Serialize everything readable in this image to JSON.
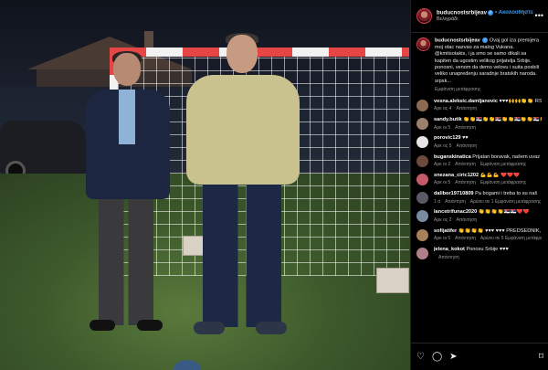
{
  "post": {
    "username": "buducnostsrbijeav",
    "verified_mark": "✓",
    "follow_label": "• Ακολουθήστε",
    "location": "Βελιγράδι",
    "more_icon": "more-horizontal-icon"
  },
  "caption": {
    "username": "buducnostsrbijeav",
    "text": "Ovaj gol iza premijera moj otac nazvao za malog Vukana. @kmitsotakis, i ja smo se samo dikali sa kapiten da ugostim velikog prijatelja Srbije. ponosni, venom da demo velovu i suita posbili veliko unapređenju saradnje bratskih naroda. srpsk...",
    "meta": "Εμφάνιση μετάφρασης"
  },
  "comments": [
    {
      "username": "vesna.aleksic.damljanovic",
      "text": "♥♥♥🙌🙌👏👏 RSCR🙌🙌😊👏 RSCR",
      "time": "Αρκ ος 4",
      "extra": "",
      "color": "#8a6a52"
    },
    {
      "username": "sandy.butik",
      "text": "👏👏🇷🇸👏👏🇷🇸👏👏🇷🇸👏👏🇷🇸👏👏 ❤️❤️💙❤️",
      "time": "Αρκ οι 5",
      "extra": "",
      "color": "#9c7f6c"
    },
    {
      "username": "porovic129",
      "text": "♥♥",
      "time": "Αρκ ος 5",
      "extra": "",
      "color": "#e6e6e6"
    },
    {
      "username": "buganskinatica",
      "text": "Prijatan boravak, našem uvaz",
      "time": "Αρκ οι 2",
      "extra": "Εμφάνιση μετάφρασης",
      "color": "#6a4a3a"
    },
    {
      "username": "snezana_ciric1202",
      "text": "💪💪💪 ❤️❤️❤️",
      "time": "Αρκ οι 5",
      "extra": "Εμφάνιση μετάφρασης",
      "color": "#c45a6a"
    },
    {
      "username": "dalibor19710809",
      "text": "Pa bogami i treba to su naš",
      "time": "1 α",
      "extra": "Αρέσει σε 1   Εμφάνιση μετάφρασης",
      "color": "#5a5a66"
    },
    {
      "username": "lancetrifunac2020",
      "text": "👏👏👏👏🇷🇸🇷🇸❤️❤️",
      "time": "Αρκ ος 2",
      "extra": "",
      "color": "#7a8aa0"
    },
    {
      "username": "sofijatifer",
      "text": "👏👏👏👏 ♥♥♥ ♥♥♥ PREDSEDNIK, DOBRO DOSLI U PRIJATELJSKU",
      "time": "Αρκ οι 5",
      "extra": "Αρέσει σε 5   Εμφάνιση μετάφρασης",
      "color": "#a8805a"
    },
    {
      "username": "jelena_kokot",
      "text": "Ponosu Srbije ♥♥♥",
      "time": "",
      "extra": "",
      "color": "#b0808a"
    }
  ],
  "reply_label": "Απάντηση",
  "actions": {
    "like_icon": "heart-icon",
    "comment_icon": "comment-icon",
    "share_icon": "send-icon",
    "save_icon": "bookmark-icon"
  }
}
